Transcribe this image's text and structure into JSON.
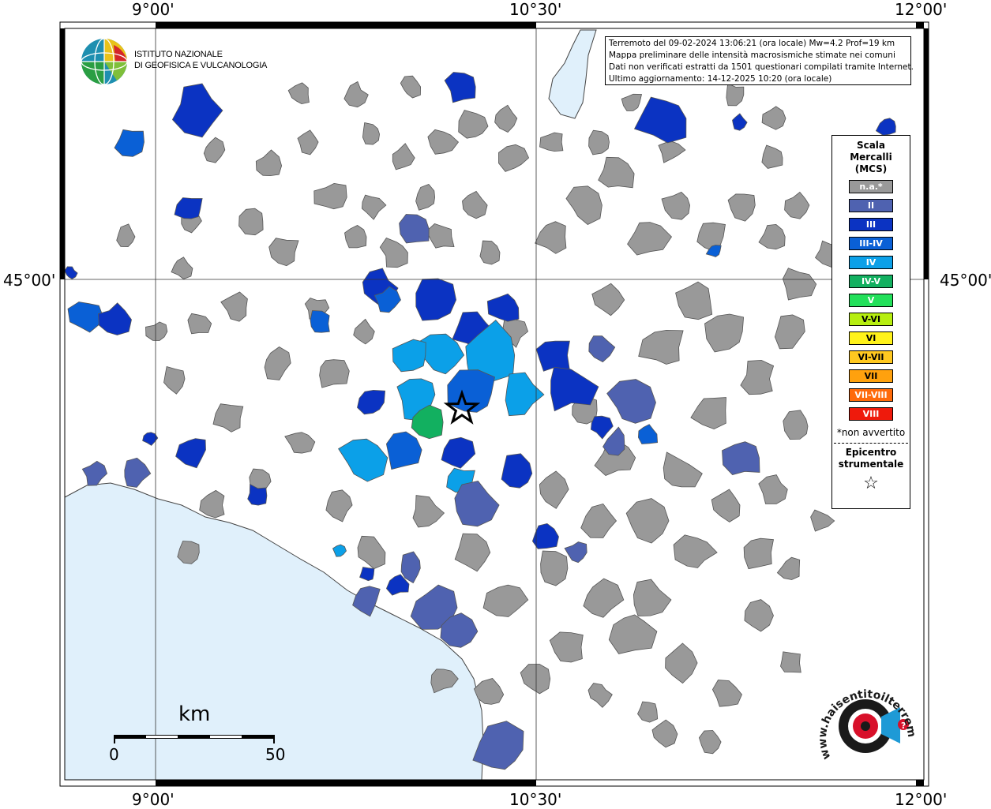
{
  "graticule": {
    "top": [
      "9°00'",
      "10°30'",
      "12°00'"
    ],
    "bottom": [
      "9°00'",
      "10°30'",
      "12°00'"
    ],
    "left": "45°00'",
    "right": "45°00'"
  },
  "info": {
    "line1": "Terremoto del 09-02-2024 13:06:21 (ora locale) Mw=4.2 Prof=19 km",
    "line2": "Mappa preliminare delle intensità macrosismiche stimate nei comuni",
    "line3": "Dati non verificati estratti da 1501 questionari compilati tramite Internet.",
    "line4": "Ultimo aggiornamento: 14-12-2025 10:20 (ora locale)"
  },
  "legend": {
    "title_line1": "Scala",
    "title_line2": "Mercalli",
    "title_line3": "(MCS)",
    "classes": [
      {
        "label": "n.a.*",
        "color": "#999999"
      },
      {
        "label": "II",
        "color": "#4f62b0"
      },
      {
        "label": "III",
        "color": "#0b33c2"
      },
      {
        "label": "III-IV",
        "color": "#0a60d6"
      },
      {
        "label": "IV",
        "color": "#0ba0e8"
      },
      {
        "label": "IV-V",
        "color": "#12b060"
      },
      {
        "label": "V",
        "color": "#22e05a"
      },
      {
        "label": "V-VI",
        "color": "#b6ee10"
      },
      {
        "label": "VI",
        "color": "#fff21a"
      },
      {
        "label": "VI-VII",
        "color": "#ffc820"
      },
      {
        "label": "VII",
        "color": "#ffa10e"
      },
      {
        "label": "VII-VIII",
        "color": "#ff6a0a"
      },
      {
        "label": "VIII",
        "color": "#ef1a0c"
      }
    ],
    "note": "*non avvertito",
    "epicenter_line1": "Epicentro",
    "epicenter_line2": "strumentale",
    "epicenter_symbol": "☆"
  },
  "logo_ingv": {
    "line1": "ISTITUTO NAZIONALE",
    "line2": "DI GEOFISICA E VULCANOLOGIA"
  },
  "logo_hsit": {
    "text": "www.haisentitoilterremoto.it"
  },
  "scalebar": {
    "unit": "km",
    "start": "0",
    "end": "50"
  },
  "colors": {
    "sea": "#e0f0fb",
    "gray": "#999999"
  }
}
